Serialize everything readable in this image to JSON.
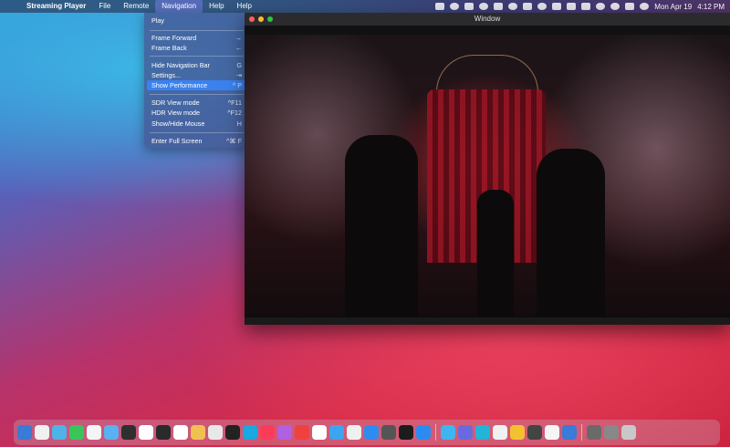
{
  "menubar": {
    "app_name": "Streaming Player",
    "menus": [
      "File",
      "Remote",
      "Navigation",
      "Help",
      "Help"
    ],
    "clock": {
      "date": "Mon Apr 19",
      "time": "4:12 PM"
    }
  },
  "navigation_menu": {
    "items": [
      {
        "label": "Play",
        "shortcut": ""
      },
      {
        "label": "Frame Forward",
        "shortcut": "→"
      },
      {
        "label": "Frame Back",
        "shortcut": "←"
      },
      {
        "label": "Hide Navigation Bar",
        "shortcut": "G"
      },
      {
        "label": "Settings...",
        "shortcut": "⇥"
      },
      {
        "label": "Show Performance",
        "shortcut": "^ P",
        "highlighted": true
      },
      {
        "label": "SDR View mode",
        "shortcut": "^F11"
      },
      {
        "label": "HDR View mode",
        "shortcut": "^F12"
      },
      {
        "label": "Show/Hide Mouse",
        "shortcut": "H"
      },
      {
        "label": "Enter Full Screen",
        "shortcut": "^⌘ F"
      }
    ]
  },
  "window": {
    "title": "Window"
  },
  "dock": {
    "app_colors": [
      "#3a7bd5",
      "#f0f0f0",
      "#4fb3e8",
      "#3bc45a",
      "#f5f5f5",
      "#5ab0f0",
      "#2f2f2f",
      "#ffffff",
      "#2a2a2a",
      "#ffffff",
      "#f0c050",
      "#e8e8e8",
      "#222222",
      "#1aa8e0",
      "#fa3c5a",
      "#b060e0",
      "#f04040",
      "#ffffff",
      "#3fa4f0",
      "#f0f0f0",
      "#2d8cf0",
      "#555555",
      "#1c1c1c",
      "#2a8cf0",
      "#3fb5f0",
      "#6a6ae0",
      "#22b5d8",
      "#f0f0f0",
      "#f5c030",
      "#444444",
      "#f5f5f5",
      "#3a7ad8",
      "#6a6a6a",
      "#888888",
      "#c8c8c8"
    ],
    "separator_indices": [
      24,
      32
    ]
  }
}
